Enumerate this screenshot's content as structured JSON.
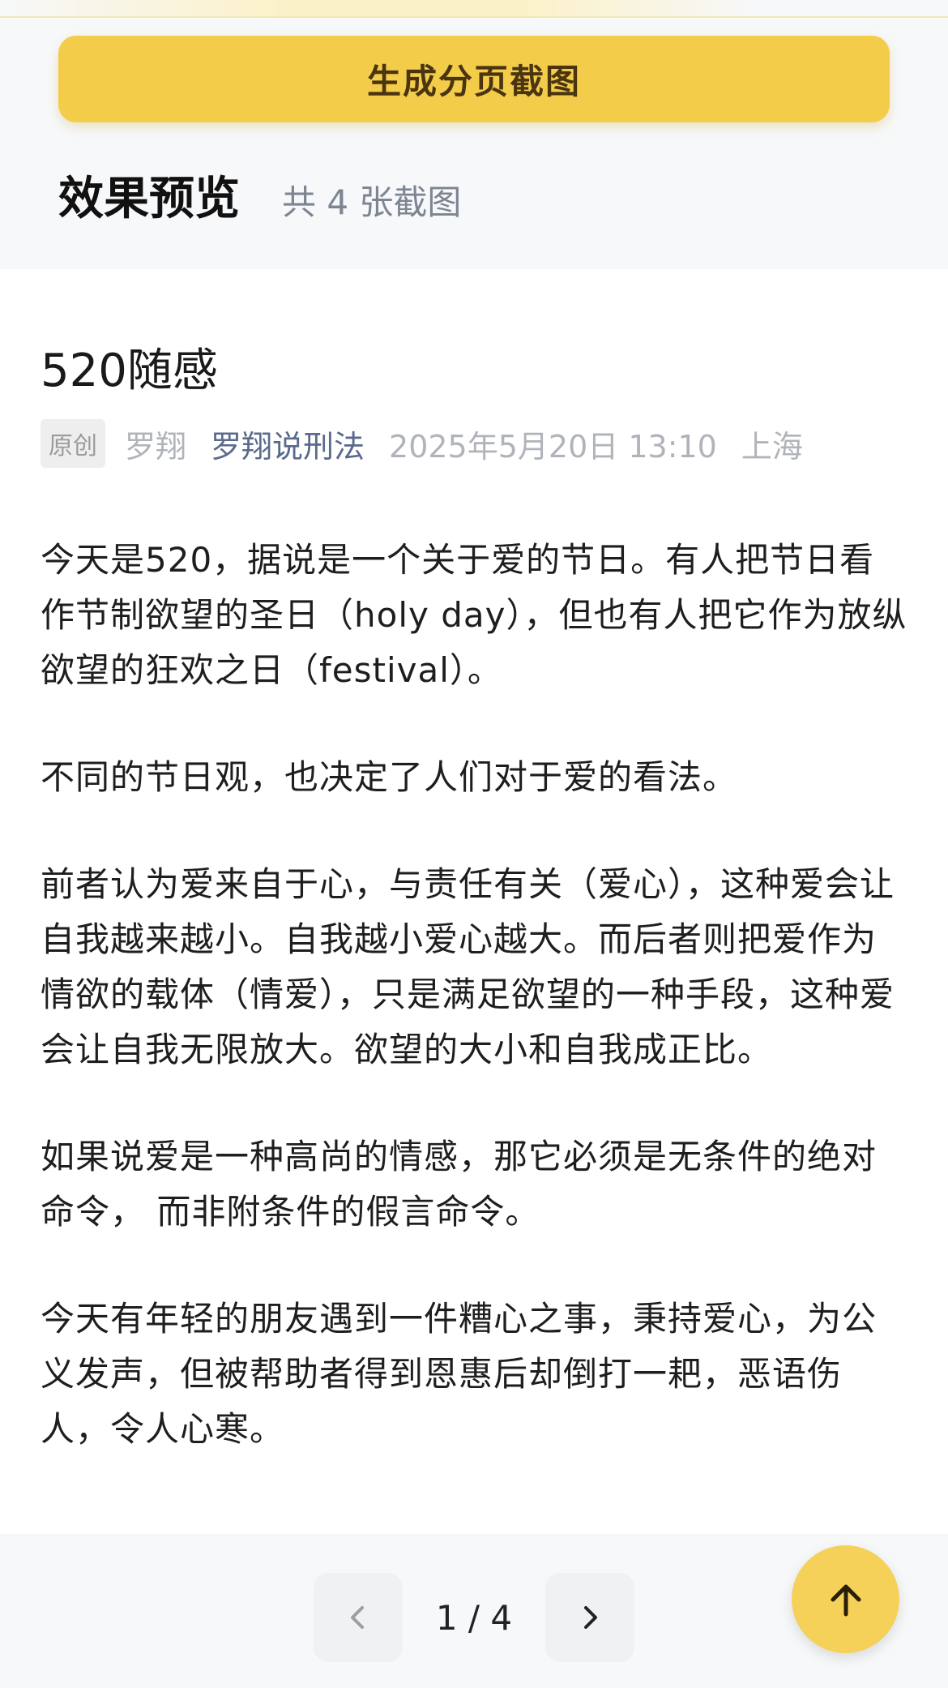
{
  "toolbar": {
    "generate_label": "生成分页截图"
  },
  "preview": {
    "title": "效果预览",
    "count": "共 4 张截图"
  },
  "article": {
    "title": "520随感",
    "badge": "原创",
    "author": "罗翔",
    "account": "罗翔说刑法",
    "date": "2025年5月20日 13:10",
    "location": "上海",
    "paragraphs": [
      "今天是520，据说是一个关于爱的节日。有人把节日看作节制欲望的圣日（holy day），但也有人把它作为放纵欲望的狂欢之日（festival）。",
      "不同的节日观，也决定了人们对于爱的看法。",
      "前者认为爱来自于心，与责任有关（爱心），这种爱会让自我越来越小。自我越小爱心越大。而后者则把爱作为情欲的载体（情爱），只是满足欲望的一种手段，这种爱会让自我无限放大。欲望的大小和自我成正比。",
      "如果说爱是一种高尚的情感，那它必须是无条件的绝对命令， 而非附条件的假言命令。",
      "今天有年轻的朋友遇到一件糟心之事，秉持爱心，为公义发声，但被帮助者得到恩惠后却倒打一耙，恶语伤人，令人心寒。"
    ]
  },
  "pagination": {
    "indicator": "1 / 4",
    "prev_icon": "chevron-left-icon",
    "next_icon": "chevron-right-icon"
  },
  "scroll_top": {
    "icon": "arrow-up-icon"
  },
  "colors": {
    "accent": "#f3cd4a",
    "account_link": "#5a6a8c"
  }
}
